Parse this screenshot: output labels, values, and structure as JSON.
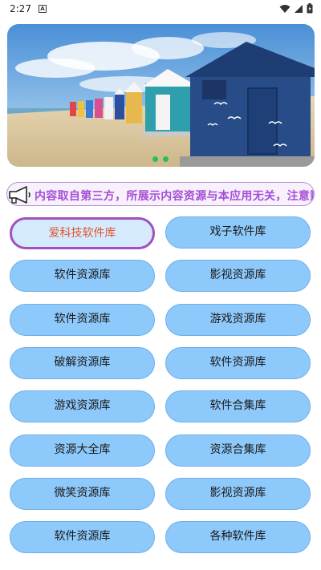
{
  "status": {
    "time": "2:27",
    "badge": "A"
  },
  "notice": {
    "text": "内容取自第三方，所展示内容资源与本应用无关，注意财产"
  },
  "library_buttons": [
    "爱科技软件库",
    "戏子软件库",
    "软件资源库",
    "影视资源库",
    "软件资源库",
    "游戏资源库",
    "破解资源库",
    "软件资源库",
    "游戏资源库",
    "软件合集库",
    "资源大全库",
    "资源合集库",
    "微笑资源库",
    "影视资源库",
    "软件资源库",
    "各种软件库"
  ],
  "active_index": 0,
  "colors": {
    "accent": "#a24fc0",
    "button": "#8ec9fb",
    "active_text": "#e0552e",
    "notice_text": "#a64dd8",
    "dot": "#27c24c"
  }
}
